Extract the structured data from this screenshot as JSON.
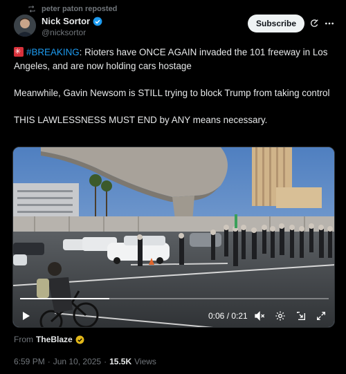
{
  "repost": {
    "text": "peter paton reposted",
    "icon": "repost-icon"
  },
  "author": {
    "name": "Nick Sortor",
    "handle": "@nicksortor",
    "verified": true,
    "verified_color": "#1d9bf0"
  },
  "actions": {
    "subscribe_label": "Subscribe"
  },
  "tweet": {
    "line1_emoji": "siren-emoji",
    "hashtag": "#BREAKING",
    "line1_rest": ": Rioters have ONCE AGAIN invaded the 101 freeway in Los Angeles, and are now holding cars hostage",
    "line2": "Meanwhile, Gavin Newsom is STILL trying to block Trump from taking control",
    "line3": "THIS LAWLESSNESS MUST END by ANY means necessary."
  },
  "video": {
    "current_time": "0:06",
    "duration": "0:21",
    "time_display": "0:06 / 0:21",
    "progress": 0.29
  },
  "source": {
    "prefix": "From",
    "name": "TheBlaze",
    "badge_color": "#e2b719"
  },
  "meta": {
    "time": "6:59 PM",
    "date": "Jun 10, 2025",
    "separator": "·",
    "views_count": "15.5K",
    "views_label": "Views"
  },
  "colors": {
    "accent": "#1d9bf0",
    "background": "#000000",
    "muted": "#71767b",
    "text": "#e7e9ea"
  }
}
